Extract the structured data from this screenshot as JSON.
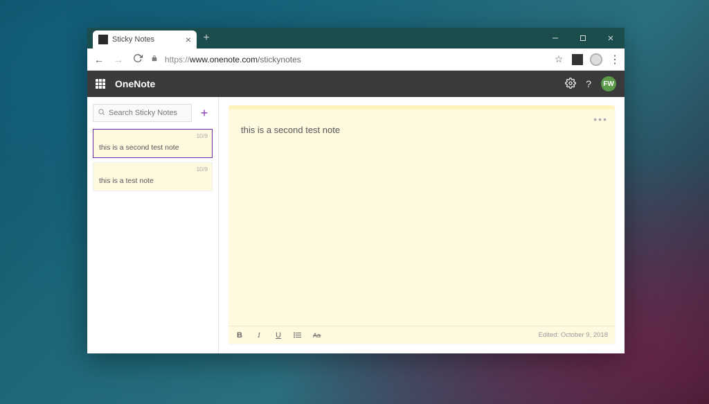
{
  "browser": {
    "tab_title": "Sticky Notes",
    "url_scheme": "https://",
    "url_domain": "www.onenote.com",
    "url_path": "/stickynotes"
  },
  "app": {
    "title": "OneNote",
    "user_initials": "FW"
  },
  "sidebar": {
    "search_placeholder": "Search Sticky Notes",
    "notes": [
      {
        "date": "10/9",
        "text": "this is a second test note"
      },
      {
        "date": "10/9",
        "text": "this is a test note"
      }
    ]
  },
  "editor": {
    "content": "this is a second test note",
    "format_buttons": {
      "bold": "B",
      "italic": "I",
      "underline": "U"
    },
    "edited_label": "Edited: October 9, 2018"
  }
}
